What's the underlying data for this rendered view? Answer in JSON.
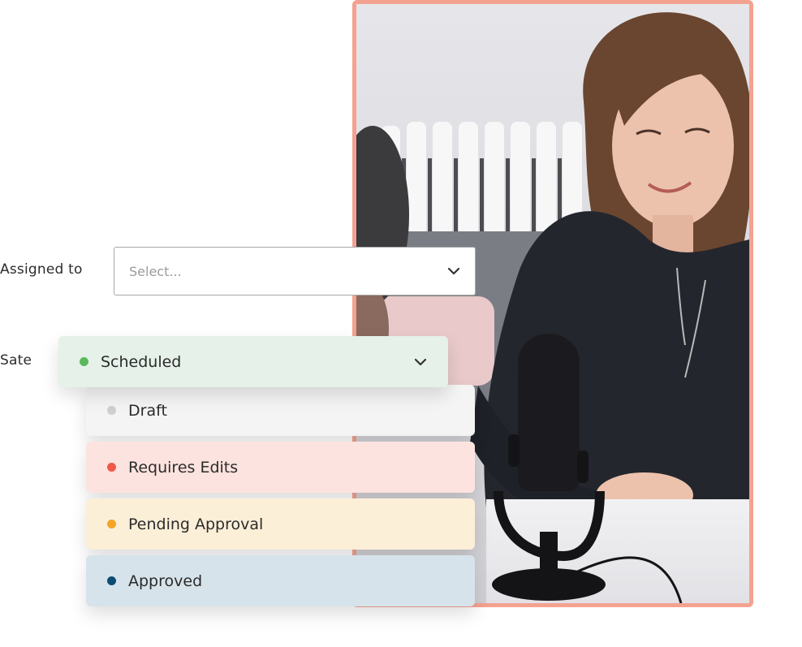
{
  "assigned_to": {
    "label": "Assigned to",
    "placeholder": "Select..."
  },
  "state": {
    "label": "Sate",
    "selected": {
      "label": "Scheduled",
      "dot_color": "#5cb85c",
      "bg_color": "#e5f1e9"
    },
    "options": [
      {
        "label": "Draft",
        "dot_color": "#cfcfcf",
        "bg_color": "#f4f4f4"
      },
      {
        "label": "Requires Edits",
        "dot_color": "#f0584a",
        "bg_color": "#fde3df"
      },
      {
        "label": "Pending Approval",
        "dot_color": "#f2a526",
        "bg_color": "#fcefd8"
      },
      {
        "label": "Approved",
        "dot_color": "#0d4a74",
        "bg_color": "#d7e3ea"
      }
    ]
  },
  "photo": {
    "frame_color": "#f4a290"
  }
}
